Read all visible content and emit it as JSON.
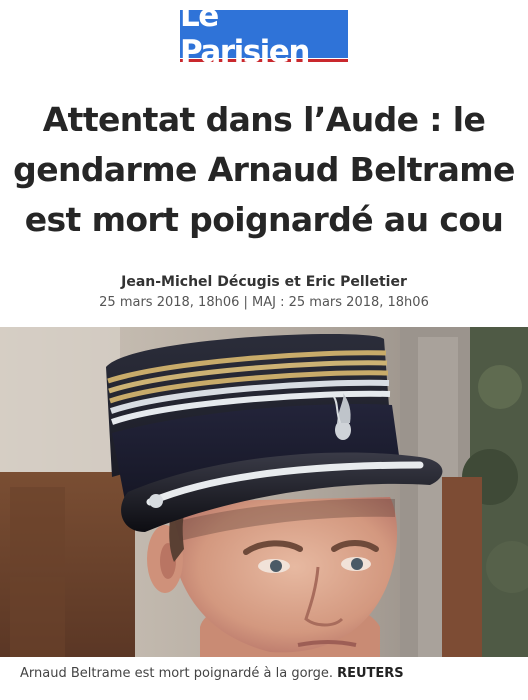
{
  "brand": {
    "name": "Le Parisien",
    "colors": {
      "logo_background": "#2f73d8",
      "logo_underline": "#c9282d"
    }
  },
  "article": {
    "headline_lines": [
      "Attentat dans l’Aude : le",
      "gendarme Arnaud Beltrame",
      "est mort poignardé au cou"
    ],
    "authors": "Jean-Michel Décugis et Eric Pelletier",
    "dates": "25 mars 2018, 18h06 | MAJ : 25 mars 2018, 18h06"
  },
  "photo": {
    "subject": "portrait of a gendarme officer wearing a kepi",
    "caption": "Arnaud Beltrame est mort poignardé à la gorge.",
    "credit": "REUTERS"
  }
}
